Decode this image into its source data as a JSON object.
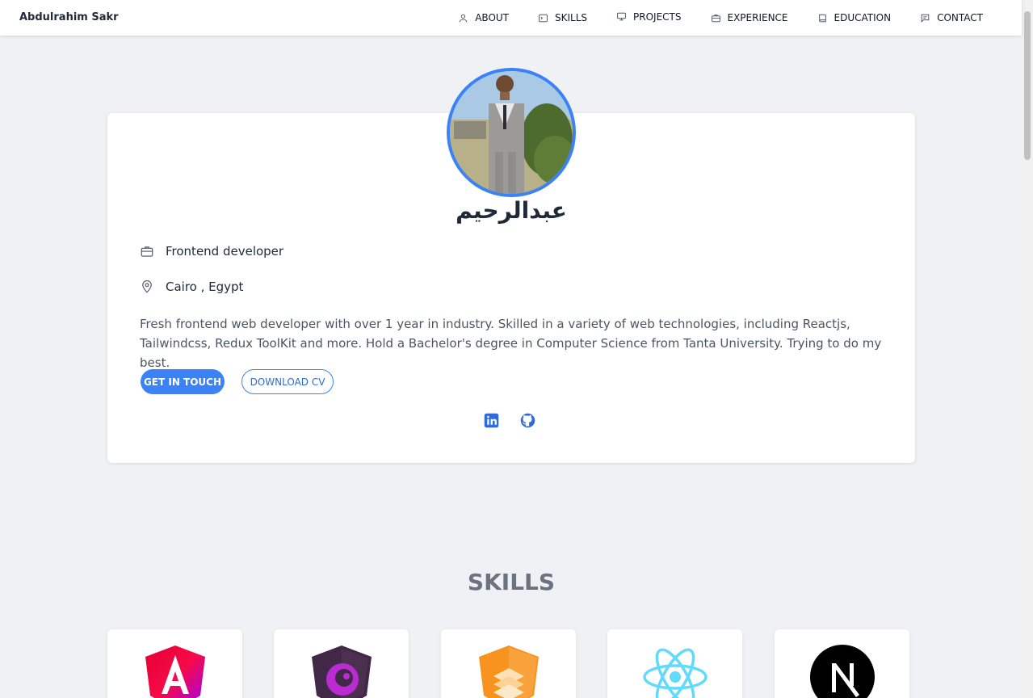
{
  "navbar": {
    "brand": "Abdulrahim Sakr",
    "links": [
      {
        "label": "ABOUT",
        "icon": "user-icon"
      },
      {
        "label": "SKILLS",
        "icon": "terminal-icon"
      },
      {
        "label": "PROJECTS",
        "icon": "monitor-icon"
      },
      {
        "label": "EXPERIENCE",
        "icon": "briefcase-icon"
      },
      {
        "label": "EDUCATION",
        "icon": "book-icon"
      },
      {
        "label": "CONTACT",
        "icon": "message-icon"
      }
    ]
  },
  "profile": {
    "name_arabic": "عبدالرحيم",
    "role": "Frontend developer",
    "location": "Cairo , Egypt",
    "bio": "Fresh frontend web developer with over 1 year in industry. Skilled in a variety of web technologies, including Reactjs, Tailwindcss, Redux ToolKit and more. Hold a Bachelor's degree in Computer Science from Tanta University. Trying to do my best.",
    "buttons": {
      "primary": "GET IN TOUCH",
      "secondary": "DOWNLOAD CV"
    },
    "social": [
      "linkedin-icon",
      "github-icon"
    ]
  },
  "skills": {
    "title": "SKILLS",
    "items": [
      "angular-logo",
      "ngrx-logo",
      "stackshare-logo",
      "react-logo",
      "nextjs-logo"
    ]
  },
  "colors": {
    "accent": "#3b82f6",
    "page_bg": "#f0f1f5",
    "card_bg": "#ffffff"
  }
}
